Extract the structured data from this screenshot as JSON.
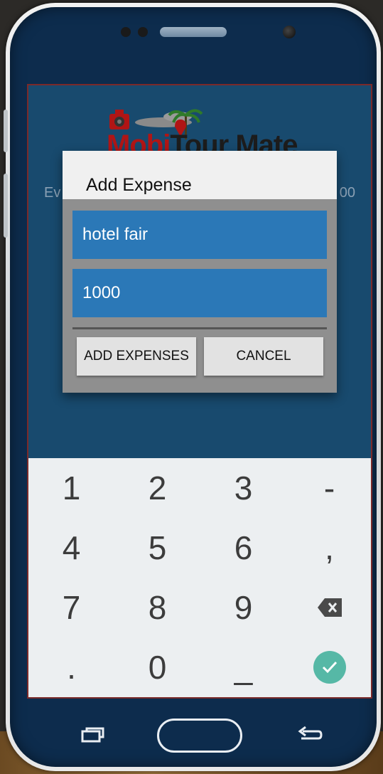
{
  "app": {
    "logo_part1": "Mobi",
    "logo_part2": "Tour Mate",
    "background_label_left": "Ev",
    "background_label_right": "00"
  },
  "dialog": {
    "title": "Add Expense",
    "description_value": "hotel fair",
    "amount_value": "1000",
    "add_button": "ADD EXPENSES",
    "cancel_button": "CANCEL"
  },
  "keyboard": {
    "rows": [
      [
        "1",
        "2",
        "3",
        "-"
      ],
      [
        "4",
        "5",
        "6",
        ","
      ],
      [
        "7",
        "8",
        "9",
        "backspace-icon"
      ],
      [
        ".",
        "0",
        "_",
        "check-icon"
      ]
    ]
  },
  "colors": {
    "app_background": "#184a6e",
    "input_field": "#2b78b7",
    "confirm_key": "#56b8a6"
  }
}
